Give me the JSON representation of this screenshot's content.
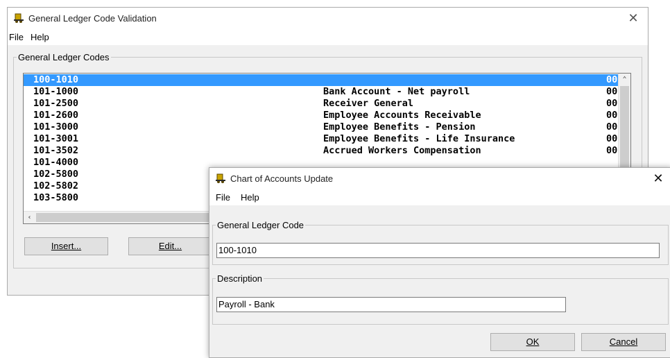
{
  "gl_window": {
    "title": "General Ledger Code Validation",
    "menu": [
      "File",
      "Help"
    ],
    "group_label": "General Ledger Codes",
    "rows": [
      {
        "code": "100-1010",
        "description": "",
        "amount": "00",
        "selected": true
      },
      {
        "code": "101-1000",
        "description": "Bank Account - Net payroll",
        "amount": "00"
      },
      {
        "code": "101-2500",
        "description": "Receiver General",
        "amount": "00"
      },
      {
        "code": "101-2600",
        "description": "Employee Accounts Receivable",
        "amount": "00"
      },
      {
        "code": "101-3000",
        "description": "Employee Benefits - Pension",
        "amount": "00"
      },
      {
        "code": "101-3001",
        "description": "Employee Benefits - Life Insurance",
        "amount": "00"
      },
      {
        "code": "101-3502",
        "description": "Accrued Workers Compensation",
        "amount": "00"
      },
      {
        "code": "101-4000",
        "description": "",
        "amount": ""
      },
      {
        "code": "102-5800",
        "description": "",
        "amount": ""
      },
      {
        "code": "102-5802",
        "description": "",
        "amount": ""
      },
      {
        "code": "103-5800",
        "description": "",
        "amount": ""
      }
    ],
    "buttons": {
      "insert": "Insert...",
      "edit": "Edit..."
    }
  },
  "coa_window": {
    "title": "Chart of Accounts Update",
    "menu": [
      "File",
      "Help"
    ],
    "gl_code_label": "General Ledger Code",
    "gl_code_value": "100-1010",
    "description_label": "Description",
    "description_value": "Payroll - Bank",
    "ok": "OK",
    "cancel": "Cancel"
  }
}
